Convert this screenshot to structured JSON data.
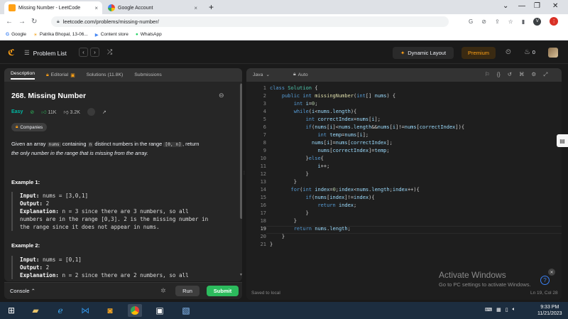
{
  "browser": {
    "tabs": [
      {
        "title": "Missing Number - LeetCode",
        "close": "×"
      },
      {
        "title": "Google Account",
        "close": "×"
      }
    ],
    "new_tab": "+",
    "url": "leetcode.com/problems/missing-number/",
    "profile_letter": "V",
    "bookmarks": [
      "Google",
      "Patrika Bhopal, 13-06...",
      "Content store",
      "WhatsApp"
    ]
  },
  "nav": {
    "problem_list": "Problem List",
    "dynamic_layout": "Dynamic Layout",
    "premium": "Premium",
    "streak": "0"
  },
  "panel_tabs": {
    "description": "Description",
    "editorial": "Editorial",
    "solutions": "Solutions (11.8K)",
    "submissions": "Submissions"
  },
  "problem": {
    "title": "268. Missing Number",
    "difficulty": "Easy",
    "likes": "11K",
    "dislikes": "3.2K",
    "companies": "Companies",
    "desc_1": "Given an array ",
    "desc_nums": "nums",
    "desc_2": " containing ",
    "desc_n": "n",
    "desc_3": " distinct numbers in the range ",
    "desc_range": "[0, n]",
    "desc_4": ", return",
    "desc_5": "the only number in the range that is missing from the array.",
    "example1_title": "Example 1:",
    "example1": {
      "input_label": "Input:",
      "input": " nums = [3,0,1]",
      "output_label": "Output:",
      "output": " 2",
      "expl_label": "Explanation:",
      "expl_1": " n = 3 since there are 3 numbers, so all",
      "expl_2": "numbers are in the range [0,3]. 2 is the missing number in",
      "expl_3": "the range since it does not appear in nums."
    },
    "example2_title": "Example 2:",
    "example2": {
      "input_label": "Input:",
      "input": " nums = [0,1]",
      "output_label": "Output:",
      "output": " 2",
      "expl_label": "Explanation:",
      "expl_1": " n = 2 since there are 2 numbers, so all"
    }
  },
  "console": {
    "label": "Console",
    "run": "Run",
    "submit": "Submit"
  },
  "editor": {
    "language": "Java",
    "mode": "Auto",
    "line_numbers": [
      "1",
      "2",
      "3",
      "4",
      "5",
      "6",
      "7",
      "8",
      "9",
      "10",
      "11",
      "12",
      "13",
      "14",
      "15",
      "16",
      "17",
      "18",
      "19",
      "20",
      "21"
    ],
    "saved": "Saved to local",
    "position": "Ln 19, Col 28"
  },
  "overlay": {
    "activate_title": "Activate Windows",
    "activate_sub": "Go to PC settings to activate Windows."
  },
  "taskbar": {
    "time": "9:33 PM",
    "date": "11/21/2023"
  }
}
